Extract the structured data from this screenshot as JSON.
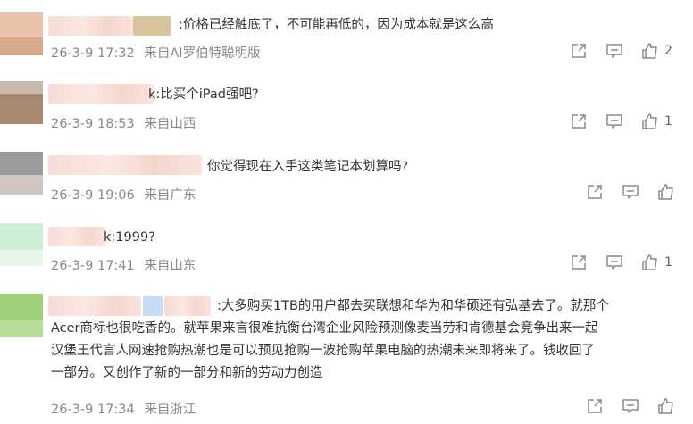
{
  "comments": [
    {
      "text": ":价格已经触底了，不可能再低的，因为成本就是这么高",
      "date": "26-3-9 17:32",
      "source": "来自AI罗伯特聪明版",
      "likes": "2",
      "avatar_colors": [
        "#e9c2aa",
        "#d6a88c"
      ],
      "name_blur_colors": [
        "#f6dcd4",
        "#d9c39a"
      ]
    },
    {
      "text": "k:比买个iPad强吧?",
      "date": "26-3-9 18:53",
      "source": "来自山西",
      "likes": "1",
      "avatar_colors": [
        "#c9b8ae",
        "#a8896f"
      ],
      "name_blur_colors": [
        "#f6dcd4",
        "#fbe8e2"
      ]
    },
    {
      "text": "你觉得现在入手这类笔记本划算吗?",
      "date": "26-3-9 19:06",
      "source": "来自广东",
      "likes": "",
      "avatar_colors": [
        "#9b9b9b",
        "#cfc6c2"
      ],
      "name_blur_colors": [
        "#f6dcd4",
        "#fae4de"
      ]
    },
    {
      "text": "k:1999?",
      "date": "26-3-9 17:41",
      "source": "来自山东",
      "likes": "1",
      "avatar_colors": [
        "#cfeed6",
        "#e8f6ea"
      ],
      "name_blur_colors": [
        "#fbe8e2",
        "#f6dcd4"
      ]
    },
    {
      "lines": [
        ":大多购买1TB的用户都去买联想和华为和华硕还有弘基去了。就那个",
        "Acer商标也很吃香的。就苹果来言很难抗衡台湾企业风险预测像麦当劳和肯德基会竞争出来一起",
        "汉堡王代言人网速抢购热潮也是可以预见抢购一波抢购苹果电脑的热潮未来即将来了。钱收回了",
        "一部分。又创作了新的一部分和新的劳动力创造"
      ],
      "date": "26-3-9 17:34",
      "source": "来自浙江",
      "likes": "",
      "avatar_colors": [
        "#9ed07a",
        "#b6dd97"
      ],
      "name_blur_colors": [
        "#f6dcd4",
        "#c7dbf5"
      ]
    }
  ],
  "icons": {
    "share": "share-icon",
    "comment": "comment-icon",
    "like": "thumbs-up-icon"
  }
}
